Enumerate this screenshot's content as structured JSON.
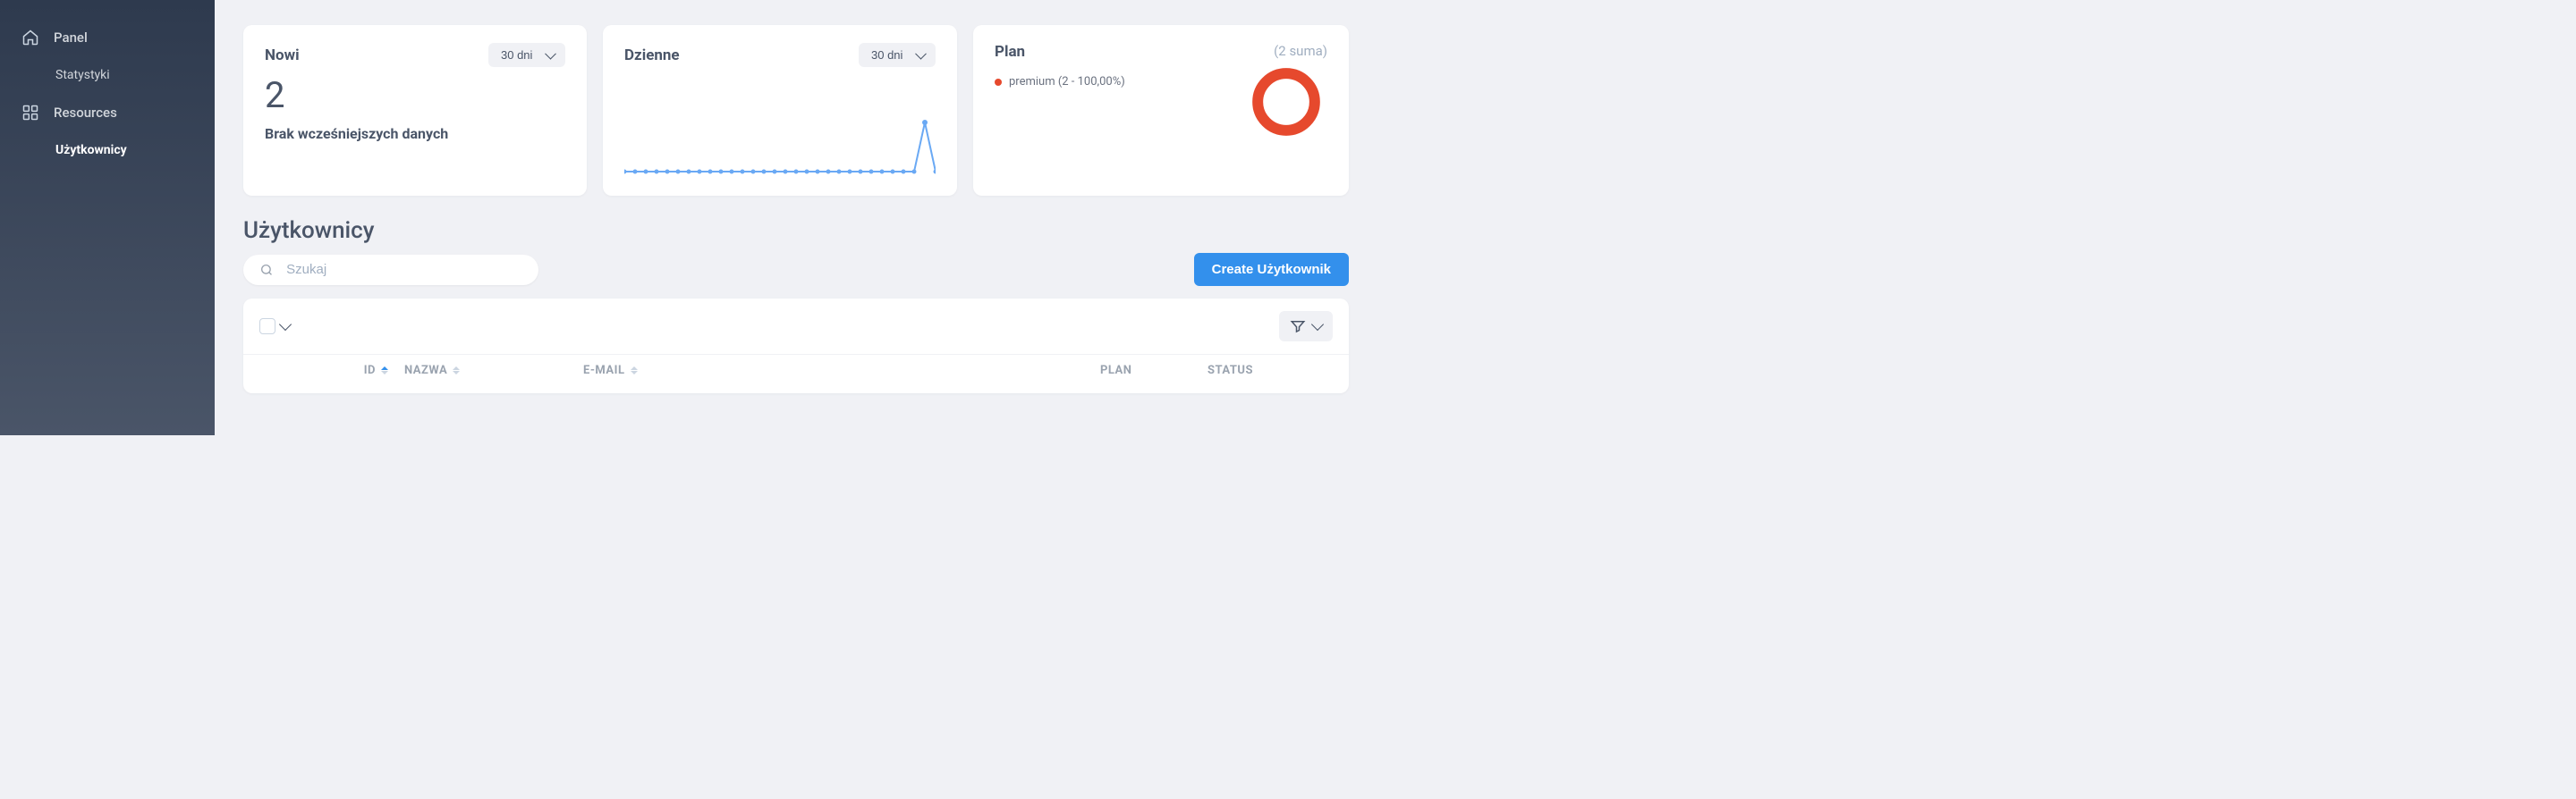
{
  "sidebar": {
    "panel_label": "Panel",
    "stats_label": "Statystyki",
    "resources_label": "Resources",
    "users_label": "Użytkownicy"
  },
  "cards": {
    "nowi": {
      "title": "Nowi",
      "range": "30 dni",
      "value": "2",
      "note": "Brak wcześniejszych danych"
    },
    "dzienne": {
      "title": "Dzienne",
      "range": "30 dni"
    },
    "plan": {
      "title": "Plan",
      "total": "(2 suma)",
      "legend": "premium (2 - 100,00%)"
    }
  },
  "page": {
    "title": "Użytkownicy",
    "search_placeholder": "Szukaj",
    "create_label": "Create Użytkownik"
  },
  "table": {
    "columns": {
      "id": "ID",
      "name": "NAZWA",
      "email": "E-MAIL",
      "plan": "PLAN",
      "status": "STATUS"
    }
  },
  "chart_data": [
    {
      "type": "line",
      "title": "Dzienne",
      "x": [
        1,
        2,
        3,
        4,
        5,
        6,
        7,
        8,
        9,
        10,
        11,
        12,
        13,
        14,
        15,
        16,
        17,
        18,
        19,
        20,
        21,
        22,
        23,
        24,
        25,
        26,
        27,
        28,
        29,
        30
      ],
      "values": [
        0,
        0,
        0,
        0,
        0,
        0,
        0,
        0,
        0,
        0,
        0,
        0,
        0,
        0,
        0,
        0,
        0,
        0,
        0,
        0,
        0,
        0,
        0,
        0,
        0,
        0,
        0,
        0,
        2,
        0
      ],
      "ylim": [
        0,
        2
      ]
    },
    {
      "type": "pie",
      "title": "Plan",
      "categories": [
        "premium"
      ],
      "values": [
        2
      ],
      "total": 2
    }
  ]
}
